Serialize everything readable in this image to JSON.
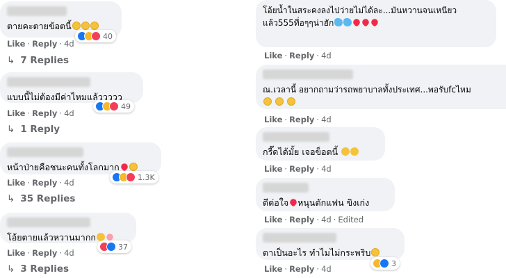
{
  "meta": {
    "like": "Like",
    "reply": "Reply",
    "sep": "·"
  },
  "left": [
    {
      "text": "ตายคะตายข้อตนี้",
      "inline_emojis": [
        "laugh",
        "laugh",
        "laugh"
      ],
      "reactions": [
        "like",
        "haha",
        "love"
      ],
      "count": "40",
      "time": "4d",
      "replies": "7 Replies"
    },
    {
      "text": "แบบนี้ไม่ต้องมีค่าไหมแล้ววววว",
      "inline_emojis": [],
      "reactions": [
        "like",
        "haha",
        "love"
      ],
      "count": "49",
      "time": "4d",
      "replies": "1 Reply"
    },
    {
      "text": "หน้าป่ายคือชนะคนทั้งโลกมาก",
      "inline_emojis": [
        "heart",
        "laugh"
      ],
      "reactions": [
        "like",
        "haha",
        "love"
      ],
      "count": "1.3K",
      "time": "4d",
      "replies": "35 Replies"
    },
    {
      "text": "โอ้ยตายแล้วหวานมากก",
      "inline_emojis": [
        "hearteyes",
        "heart"
      ],
      "reactions": [
        "love",
        "like"
      ],
      "count": "37",
      "time": "4d",
      "replies": "3 Replies"
    }
  ],
  "right": [
    {
      "text_line1": "โอ้ยน้ำในสระคงลงไปว่ายไม่ได้ละ...มันหวานจนเหนียว",
      "text_line2": "แล้ว555ที่อๆๆน่าฮัก",
      "inline_emojis": [
        "dolphin",
        "dolphin",
        "heart",
        "heart",
        "heart"
      ],
      "time": "4d",
      "edited": ""
    },
    {
      "text_line1": "ณ.เวลานี้ อยากถามว่ารถพยาบาลทั้งประเทศ...พอรับfcไหม",
      "text_line2": "",
      "inline_emojis": [
        "laugh",
        "laugh",
        "laugh"
      ],
      "time": "4d",
      "edited": ""
    },
    {
      "text_line1": "กรี๊ดได้มั้ย เจอข็อตนี้",
      "text_line2": "",
      "inline_emojis": [
        "hearteyes",
        "hearteyes"
      ],
      "time": "4d",
      "edited": ""
    },
    {
      "text_line1": "ดีต่อใจ",
      "text_line1b": "หนุนตักแฟน ขิงเก่ง",
      "text_line2": "",
      "inline_emojis": [
        "heart"
      ],
      "time": "4d",
      "edited": "Edited"
    },
    {
      "text_line1": "ตาเป็นอะไร ทำไมไม่กระพริบ",
      "text_line2": "",
      "inline_emojis": [
        "laugh"
      ],
      "reactions": [
        "haha",
        "like"
      ],
      "count": "3",
      "time": "4d",
      "edited": ""
    }
  ],
  "colors": {
    "bubble": "#f0f2f5",
    "meta": "#65676b",
    "like_blue": "#1877f2",
    "love_red": "#f33e58",
    "haha_yellow": "#f7b928"
  }
}
